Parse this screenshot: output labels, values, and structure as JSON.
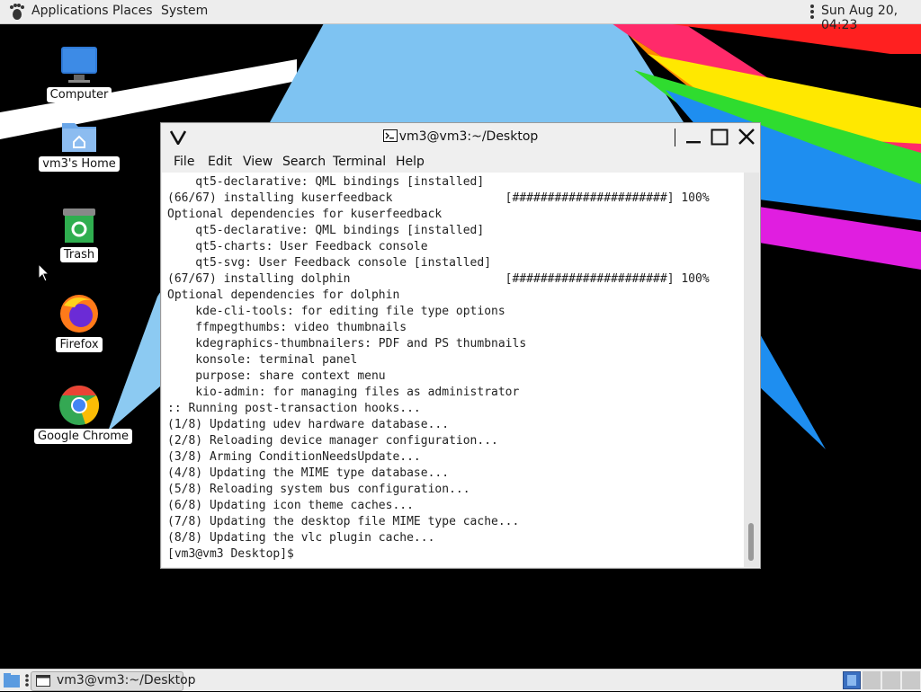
{
  "top_panel": {
    "menu": [
      "Applications",
      "Places",
      "System"
    ],
    "clock": "Sun Aug 20, 04:23"
  },
  "desktop": {
    "icons": [
      {
        "label": "Computer",
        "icon": "monitor-icon"
      },
      {
        "label": "vm3's Home",
        "icon": "home-folder-icon"
      },
      {
        "label": "Trash",
        "icon": "trash-icon"
      },
      {
        "label": "Firefox",
        "icon": "firefox-icon"
      },
      {
        "label": "Google Chrome",
        "icon": "chrome-icon"
      }
    ]
  },
  "terminal": {
    "title": "vm3@vm3:~/Desktop",
    "menu": [
      "File",
      "Edit",
      "View",
      "Search",
      "Terminal",
      "Help"
    ],
    "lines": [
      "    qt5-declarative: QML bindings [installed]",
      "(66/67) installing kuserfeedback                [######################] 100%",
      "Optional dependencies for kuserfeedback",
      "    qt5-declarative: QML bindings [installed]",
      "    qt5-charts: User Feedback console",
      "    qt5-svg: User Feedback console [installed]",
      "(67/67) installing dolphin                      [######################] 100%",
      "Optional dependencies for dolphin",
      "    kde-cli-tools: for editing file type options",
      "    ffmpegthumbs: video thumbnails",
      "    kdegraphics-thumbnailers: PDF and PS thumbnails",
      "    konsole: terminal panel",
      "    purpose: share context menu",
      "    kio-admin: for managing files as administrator",
      ":: Running post-transaction hooks...",
      "(1/8) Updating udev hardware database...",
      "(2/8) Reloading device manager configuration...",
      "(3/8) Arming ConditionNeedsUpdate...",
      "(4/8) Updating the MIME type database...",
      "(5/8) Reloading system bus configuration...",
      "(6/8) Updating icon theme caches...",
      "(7/8) Updating the desktop file MIME type cache...",
      "(8/8) Updating the vlc plugin cache...",
      "[vm3@vm3 Desktop]$ "
    ]
  },
  "taskbar": {
    "window_title": "vm3@vm3:~/Desktop"
  },
  "colors": {
    "panel_bg": "#ededed",
    "terminal_bg": "#ffffff",
    "terminal_text": "#222222",
    "desktop_bg": "#000000"
  }
}
